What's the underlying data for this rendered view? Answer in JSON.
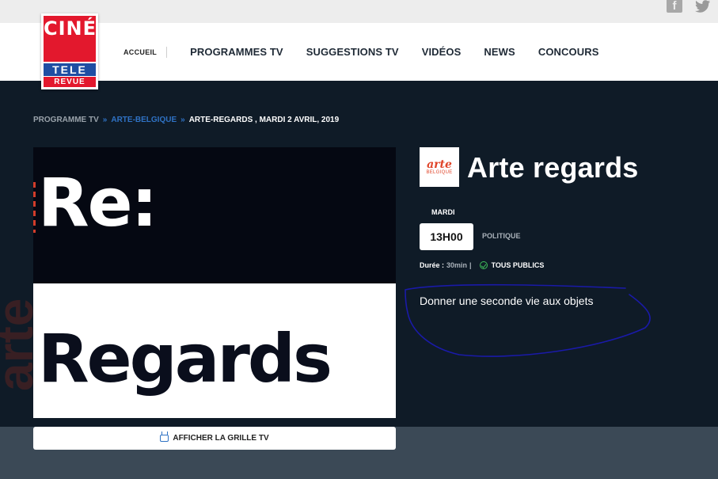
{
  "social": {
    "facebook_icon": "facebook-icon",
    "twitter_icon": "twitter-icon"
  },
  "logo": {
    "line1": "CINÉ",
    "line2": "TELE",
    "line3": "REVUE"
  },
  "nav": {
    "accueil": "ACCUEIL",
    "items": [
      "PROGRAMMES TV",
      "SUGGESTIONS TV",
      "VIDÉOS",
      "NEWS",
      "CONCOURS"
    ]
  },
  "breadcrumb": {
    "level1": "PROGRAMME TV",
    "separator": "»",
    "level2": "ARTE-BELGIQUE",
    "current": "ARTE-REGARDS , MARDI 2 AVRIL, 2019"
  },
  "poster": {
    "line1": "Re:",
    "line2": "Regards"
  },
  "grid_button": {
    "label": "AFFICHER LA GRILLE TV",
    "icon": "tv-icon"
  },
  "channel": {
    "name": "arte",
    "subname": "BELGIQUE"
  },
  "show": {
    "title": "Arte regards",
    "day": "MARDI",
    "time": "13H00",
    "genre": "POLITIQUE",
    "duration_label": "Durée :",
    "duration_value": "30min",
    "duration_sep": "|",
    "audience": "TOUS PUBLICS",
    "description": "Donner une seconde vie aux objets"
  },
  "colors": {
    "accent_blue": "#2f72c4",
    "brand_red": "#e3182d",
    "dark_bg": "#0f1b27",
    "annotation_stroke": "#1a1aa8"
  }
}
